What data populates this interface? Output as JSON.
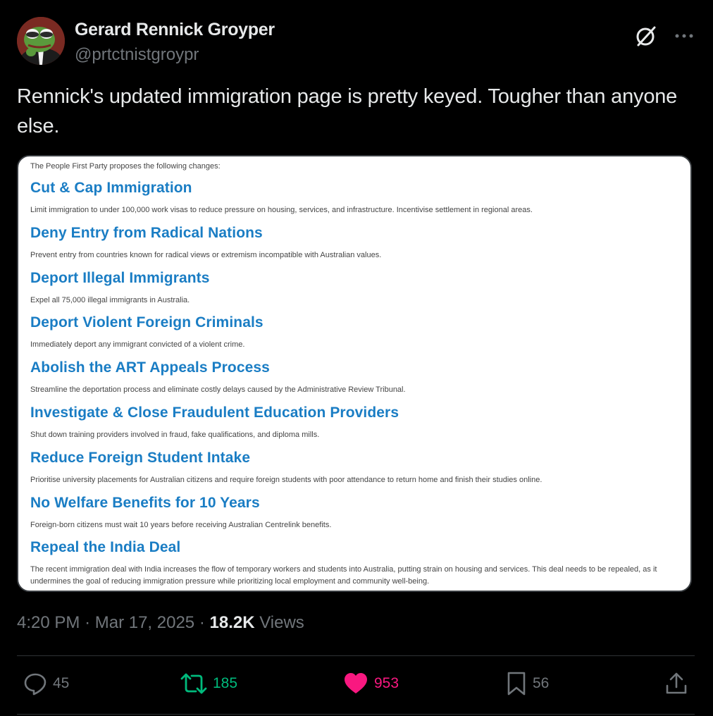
{
  "user": {
    "display_name": "Gerard Rennick Groyper",
    "handle": "@prtctnistgroypr"
  },
  "header_icons": [
    "grok-icon",
    "more-icon"
  ],
  "tweet": {
    "text": "Rennick's updated immigration page is pretty keyed. Tougher than anyone else."
  },
  "media": {
    "intro": "The People First Party proposes the following changes:",
    "items": [
      {
        "heading": "Cut & Cap Immigration",
        "desc": "Limit immigration to under 100,000 work visas to reduce pressure on housing, services, and infrastructure. Incentivise settlement in regional areas."
      },
      {
        "heading": "Deny Entry from Radical Nations",
        "desc": "Prevent entry from countries known for radical views or extremism incompatible with Australian values."
      },
      {
        "heading": "Deport Illegal Immigrants",
        "desc": "Expel all 75,000 illegal immigrants in Australia."
      },
      {
        "heading": "Deport Violent Foreign Criminals",
        "desc": "Immediately deport any immigrant convicted of a violent crime."
      },
      {
        "heading": "Abolish the ART Appeals Process",
        "desc": "Streamline the deportation process and eliminate costly delays caused by the Administrative Review Tribunal."
      },
      {
        "heading": "Investigate & Close Fraudulent Education Providers",
        "desc": "Shut down training providers involved in fraud, fake qualifications, and diploma mills."
      },
      {
        "heading": "Reduce Foreign Student Intake",
        "desc": "Prioritise university placements for Australian citizens and require foreign students with poor attendance to return home and finish their studies online."
      },
      {
        "heading": "No Welfare Benefits for 10 Years",
        "desc": "Foreign-born citizens must wait 10 years before receiving Australian Centrelink benefits."
      },
      {
        "heading": "Repeal the India Deal",
        "desc": "The recent immigration deal with India increases the flow of temporary workers and students into Australia, putting strain on housing and services. This deal needs to be repealed, as it undermines the goal of reducing immigration pressure while prioritizing local employment and community well-being."
      }
    ]
  },
  "meta": {
    "time": "4:20 PM",
    "separator": "·",
    "date": "Mar 17, 2025",
    "views_count": "18.2K",
    "views_label": "Views"
  },
  "actions": {
    "replies": "45",
    "retweets": "185",
    "likes": "953",
    "bookmarks": "56"
  },
  "colors": {
    "background": "#000000",
    "text_primary": "#e7e9ea",
    "text_secondary": "#71767b",
    "retweet_active": "#00ba7c",
    "like_active": "#f91880",
    "policy_heading": "#1a7dc4"
  }
}
